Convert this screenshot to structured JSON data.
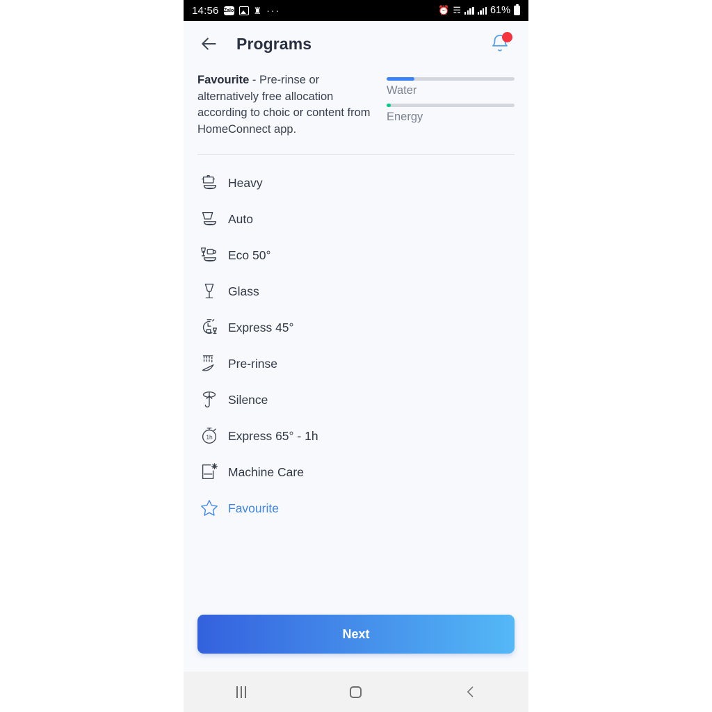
{
  "statusbar": {
    "time": "14:56",
    "zalo_label": "Zalo",
    "overflow": "···",
    "battery_percent": "61%",
    "icons": [
      "zalo-icon",
      "image-icon",
      "app-icon",
      "more-dots-icon",
      "alarm-icon",
      "wifi-icon",
      "signal-icon",
      "signal-icon",
      "battery-icon"
    ]
  },
  "header": {
    "title": "Programs",
    "back_icon": "back-arrow-icon",
    "bell_icon": "notification-bell-icon",
    "has_badge": true,
    "badge_color": "#f5333f"
  },
  "info": {
    "description_bold": "Favourite",
    "description_rest": " - Pre-rinse or alternatively free allocation according to choic or content from HomeConnect app.",
    "meters": [
      {
        "label": "Water",
        "percent": 22,
        "color": "#3b82f6"
      },
      {
        "label": "Energy",
        "percent": 3,
        "color": "#00cc82"
      }
    ]
  },
  "programs": [
    {
      "label": "Heavy",
      "icon": "pot-with-lid-icon",
      "selected": false
    },
    {
      "label": "Auto",
      "icon": "bowl-plate-icon",
      "selected": false
    },
    {
      "label": "Eco 50°",
      "icon": "glass-cup-plate-icon",
      "selected": false
    },
    {
      "label": "Glass",
      "icon": "wine-glass-icon",
      "selected": false
    },
    {
      "label": "Express 45°",
      "icon": "timer-glass-icon",
      "selected": false
    },
    {
      "label": "Pre-rinse",
      "icon": "spray-rinse-icon",
      "selected": false
    },
    {
      "label": "Silence",
      "icon": "silence-feather-icon",
      "selected": false
    },
    {
      "label": "Express 65° - 1h",
      "icon": "stopwatch-1h-icon",
      "selected": false
    },
    {
      "label": "Machine Care",
      "icon": "machine-sparkle-icon",
      "selected": false
    },
    {
      "label": "Favourite",
      "icon": "star-icon",
      "selected": true
    }
  ],
  "footer": {
    "next_label": "Next",
    "gradient_from": "#3461de",
    "gradient_to": "#54b8f6"
  },
  "navbar": {
    "recents_icon": "recents-icon",
    "home_icon": "home-icon",
    "back_icon": "nav-back-icon"
  }
}
